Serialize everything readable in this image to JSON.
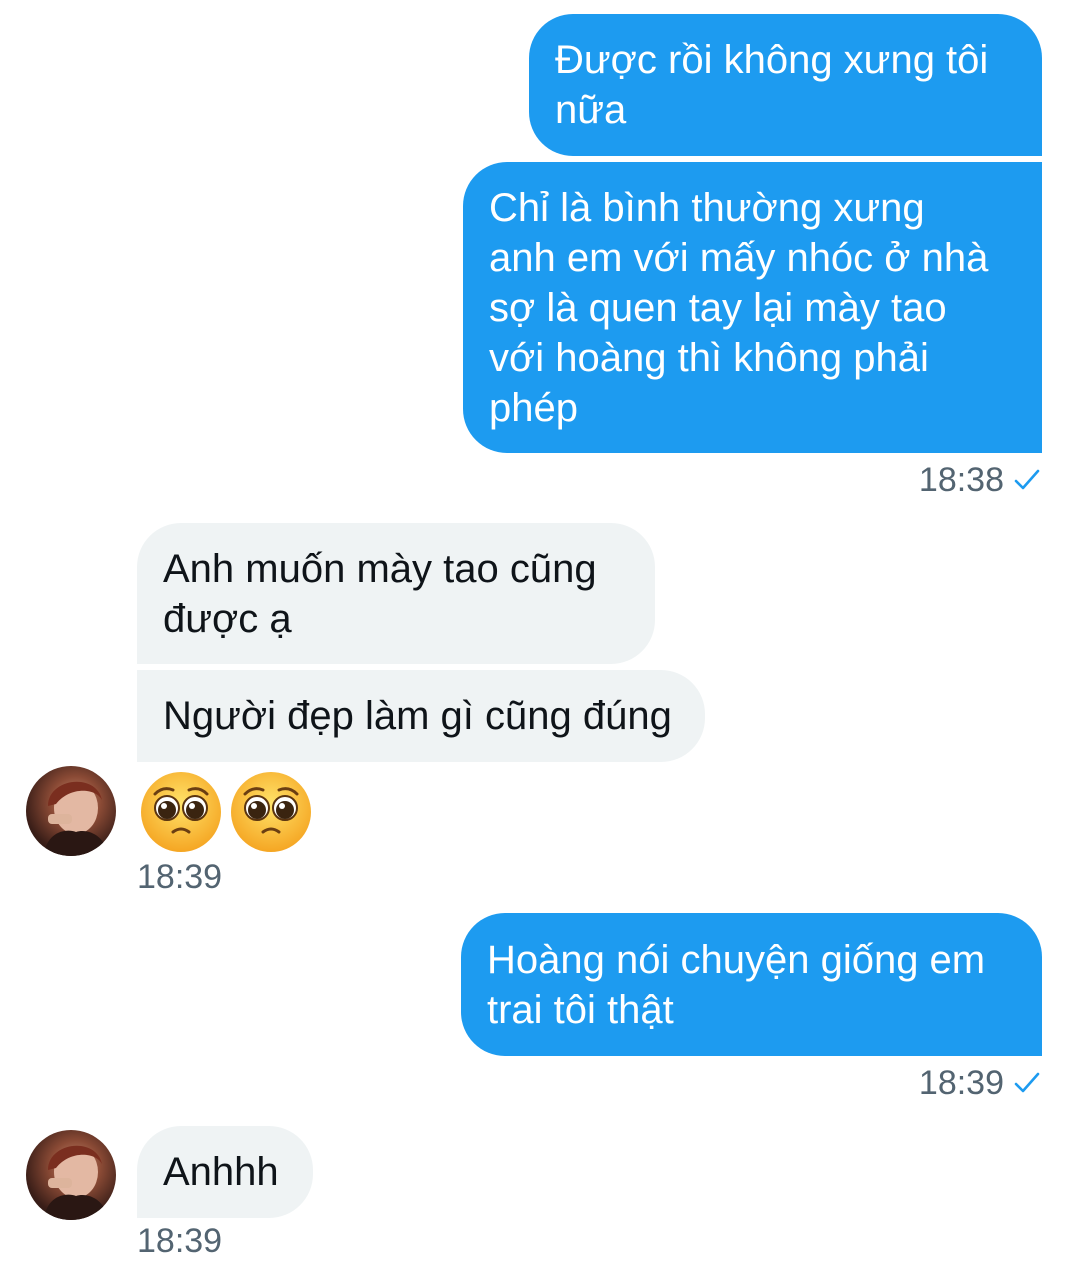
{
  "conversation": {
    "messages": [
      {
        "sender": "me",
        "text": "Được rồi không xưng tôi\nnữa"
      },
      {
        "sender": "me",
        "text": "Chỉ là bình thường xưng\nanh em với mấy nhóc ở nhà\nsợ là quen tay lại mày tao\nvới hoàng thì không phải\nphép"
      },
      {
        "sender": "them",
        "text": "Anh muốn mày tao cũng\nđược ạ"
      },
      {
        "sender": "them",
        "text": "Người đẹp làm gì cũng đúng"
      },
      {
        "sender": "them",
        "emoji": [
          "pleading-face",
          "pleading-face"
        ]
      },
      {
        "sender": "me",
        "text": "Hoàng nói chuyện giống em\ntrai tôi thật"
      },
      {
        "sender": "them",
        "text": "Anhhh"
      }
    ],
    "timestamps": {
      "t1": "18:38",
      "t2": "18:39",
      "t3": "18:39",
      "t4": "18:39"
    }
  },
  "icons": {
    "read_check": "check-icon",
    "avatar": "avatar"
  },
  "colors": {
    "outgoing_bubble": "#1d9bf0",
    "incoming_bubble": "#eff3f4",
    "check": "#1d9bf0"
  }
}
